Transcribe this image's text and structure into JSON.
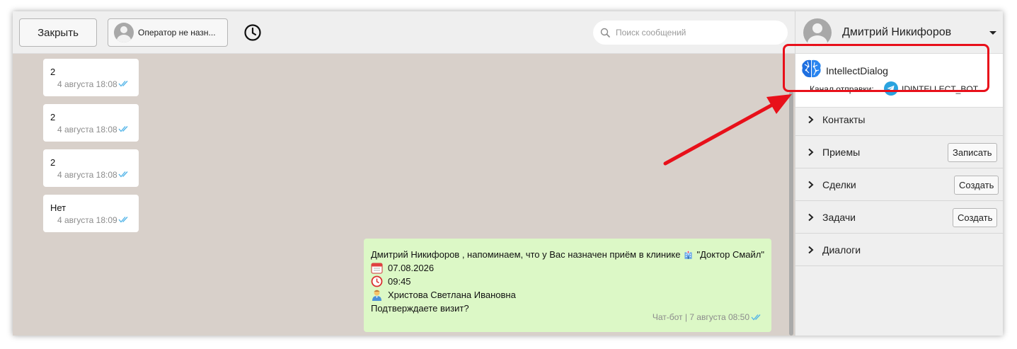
{
  "toolbar": {
    "close_label": "Закрыть",
    "operator_label": "Оператор не назн...",
    "search_placeholder": "Поиск сообщений"
  },
  "messages": [
    {
      "text": "2",
      "time": "4 августа 18:08",
      "status": "read"
    },
    {
      "text": "2",
      "time": "4 августа 18:08",
      "status": "read"
    },
    {
      "text": "2",
      "time": "4 августа 18:08",
      "status": "read"
    },
    {
      "text": "Нет",
      "time": "4 августа 18:09",
      "status": "read"
    }
  ],
  "bot_message": {
    "line1": "Дмитрий Никифоров , напоминаем, что у Вас назначен приём в клинике",
    "clinic": "\"Доктор Смайл\"",
    "date": "07.08.2026",
    "time": "09:45",
    "doctor": "Христова Светлана Ивановна",
    "question": "Подтверждаете визит?",
    "meta": "Чат-бот | 7 августа 08:50",
    "icons": [
      "hospital-icon",
      "calendar-icon",
      "clock-icon",
      "doctor-icon"
    ]
  },
  "panel": {
    "user_name": "Дмитрий Никифоров",
    "channel": {
      "name": "IntellectDialog",
      "send_label": "Канал отправки:",
      "bot_name": "IDINTELLECT_BOT"
    },
    "sections": [
      {
        "label": "Контакты",
        "action": ""
      },
      {
        "label": "Приемы",
        "action": "Записать"
      },
      {
        "label": "Сделки",
        "action": "Создать"
      },
      {
        "label": "Задачи",
        "action": "Создать"
      },
      {
        "label": "Диалоги",
        "action": ""
      }
    ]
  },
  "colors": {
    "highlight": "#e8101a",
    "arrow": "#e8101a",
    "chat_bg": "#d8d0ca",
    "bot_bubble": "#dcf8c6",
    "read_ticks": "#4fb3e8",
    "telegram": "#2aa3df",
    "logo": "#1e6fe0"
  }
}
